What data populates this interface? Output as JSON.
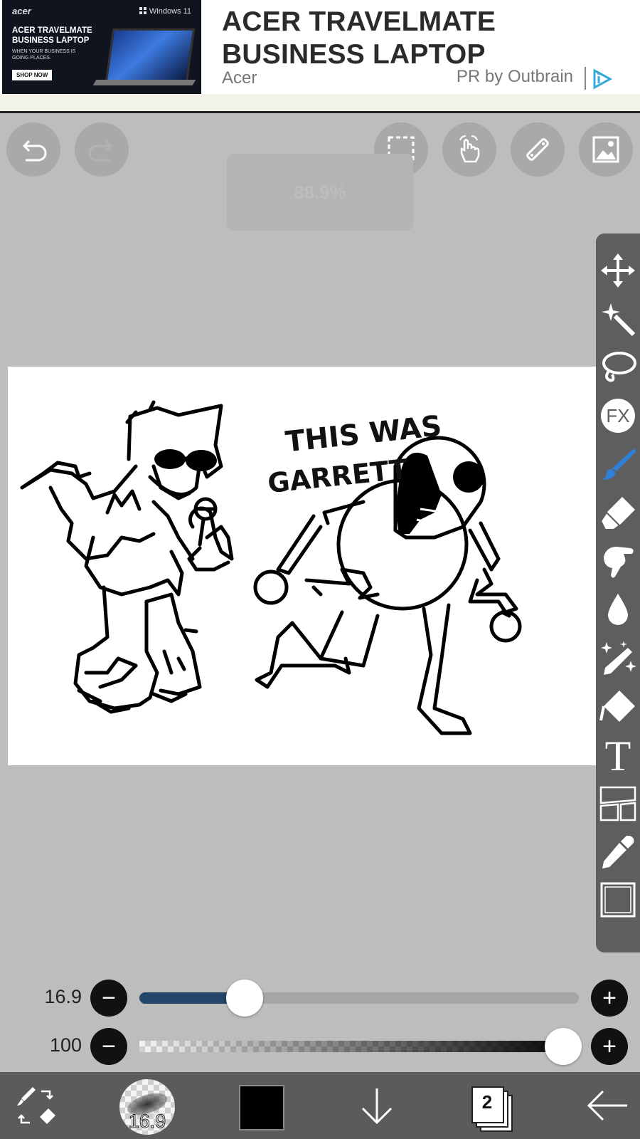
{
  "ad": {
    "image_brand": "acer",
    "image_windows": "Windows 11",
    "image_headline": "ACER TRAVELMATE BUSINESS LAPTOP",
    "image_sub": "WHEN YOUR BUSINESS IS GOING PLACES.",
    "image_cta": "SHOP NOW",
    "title_line1": "ACER TRAVELMATE",
    "title_line2": "BUSINESS LAPTOP",
    "source": "Acer",
    "sponsor": "PR by Outbrain"
  },
  "toolbar_top": {
    "undo": "undo-icon",
    "redo": "redo-icon",
    "selection": "selection-icon",
    "hand": "hand-icon",
    "ruler": "ruler-icon",
    "image": "image-icon"
  },
  "zoom_label": "88.9%",
  "canvas": {
    "caption_line1": "THIS WAS",
    "caption_line2": "GARRETT"
  },
  "tools": [
    {
      "name": "move-icon"
    },
    {
      "name": "magic-wand-icon"
    },
    {
      "name": "lasso-icon"
    },
    {
      "name": "fx-icon",
      "label": "FX"
    },
    {
      "name": "brush-icon",
      "active": true
    },
    {
      "name": "eraser-icon"
    },
    {
      "name": "smudge-icon"
    },
    {
      "name": "blur-icon"
    },
    {
      "name": "special-pen-icon"
    },
    {
      "name": "fill-icon"
    },
    {
      "name": "text-icon",
      "label": "T"
    },
    {
      "name": "frame-divider-icon"
    },
    {
      "name": "eyedropper-icon"
    },
    {
      "name": "canvas-icon"
    }
  ],
  "brush": {
    "size_label": "16.9",
    "size_fraction": 0.22,
    "opacity_label": "100",
    "opacity_fraction": 1.0
  },
  "bottom": {
    "brush_thumb_label": "16.9",
    "color": "#000000",
    "layer_count": "2"
  },
  "colors": {
    "accent": "#2f7fd6",
    "slider_fill": "#24466a"
  }
}
